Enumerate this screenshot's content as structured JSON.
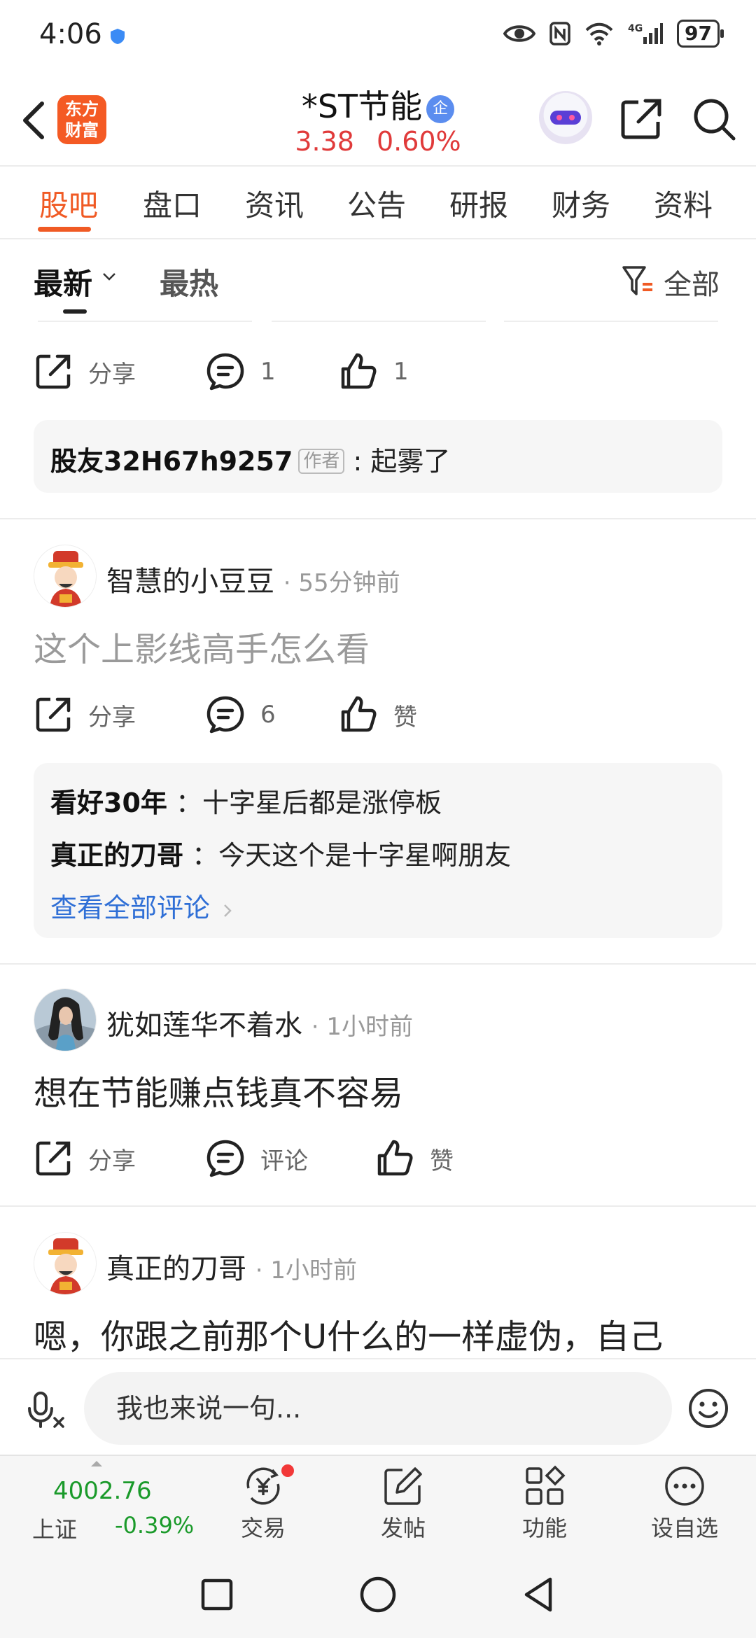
{
  "status_bar": {
    "time": "4:06",
    "battery": "97",
    "network": "4G"
  },
  "header": {
    "logo_text": "东方\n财富",
    "stock_name": "*ST节能",
    "enterprise_badge": "企",
    "price": "3.38",
    "change_pct": "0.60%"
  },
  "tabs": [
    {
      "label": "股吧",
      "active": true
    },
    {
      "label": "盘口"
    },
    {
      "label": "资讯"
    },
    {
      "label": "公告"
    },
    {
      "label": "研报"
    },
    {
      "label": "财务"
    },
    {
      "label": "资料"
    }
  ],
  "sort": {
    "latest": "最新",
    "hot": "最热",
    "filter": "全部"
  },
  "posts": [
    {
      "actions": {
        "share": "分享",
        "comments": "1",
        "likes": "1"
      },
      "reply": {
        "user": "股友32H67h9257",
        "tag": "作者",
        "text": ": 起雾了"
      }
    },
    {
      "user": "智慧的小豆豆",
      "time": "· 55分钟前",
      "body": "这个上影线高手怎么看",
      "actions": {
        "share": "分享",
        "comments": "6",
        "likes": "赞"
      },
      "replies": [
        {
          "user": "看好30年",
          "text": "：十字星后都是涨停板"
        },
        {
          "user": "真正的刀哥",
          "text": "：今天这个是十字星啊朋友"
        }
      ],
      "view_all": "查看全部评论"
    },
    {
      "user": "犹如莲华不着水",
      "time": "· 1小时前",
      "body": "想在节能赚点钱真不容易",
      "actions": {
        "share": "分享",
        "comments": "评论",
        "likes": "赞"
      }
    },
    {
      "user": "真正的刀哥",
      "time": "· 1小时前",
      "body": "嗯，你跟之前那个U什么的一样虚伪，自己"
    }
  ],
  "comment_bar": {
    "placeholder": "我也来说一句..."
  },
  "bottom_nav": {
    "index_value": "4002.76",
    "index_name": "上证",
    "index_change": "-0.39%",
    "items": [
      "交易",
      "发帖",
      "功能",
      "设自选"
    ]
  },
  "colors": {
    "accent": "#f05a24",
    "up": "#e03a3a",
    "down": "#1a9a2a",
    "link": "#2f6fd6"
  }
}
